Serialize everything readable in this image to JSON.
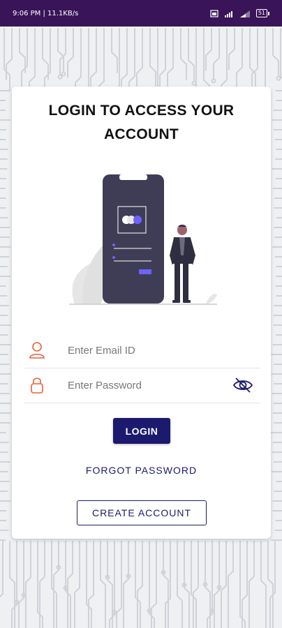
{
  "status_bar": {
    "time_speed": "9:06 PM | 11.1KB/s",
    "battery": "51"
  },
  "card": {
    "title_line1": "LOGIN TO ACCESS YOUR",
    "title_line2": "ACCOUNT"
  },
  "email": {
    "placeholder": "Enter Email ID",
    "value": "",
    "icon": "user-icon"
  },
  "password": {
    "placeholder": "Enter Password",
    "value": "",
    "icon": "lock-icon",
    "toggle_icon": "eye-off-icon"
  },
  "buttons": {
    "login": "LOGIN",
    "forgot": "FORGOT PASSWORD",
    "create": "CREATE ACCOUNT"
  },
  "colors": {
    "status_bar": "#3a1458",
    "primary": "#1b1a6e",
    "icon_accent": "#e8613a",
    "illustration_phone": "#3f3d56",
    "illustration_accent": "#6c63ff"
  }
}
